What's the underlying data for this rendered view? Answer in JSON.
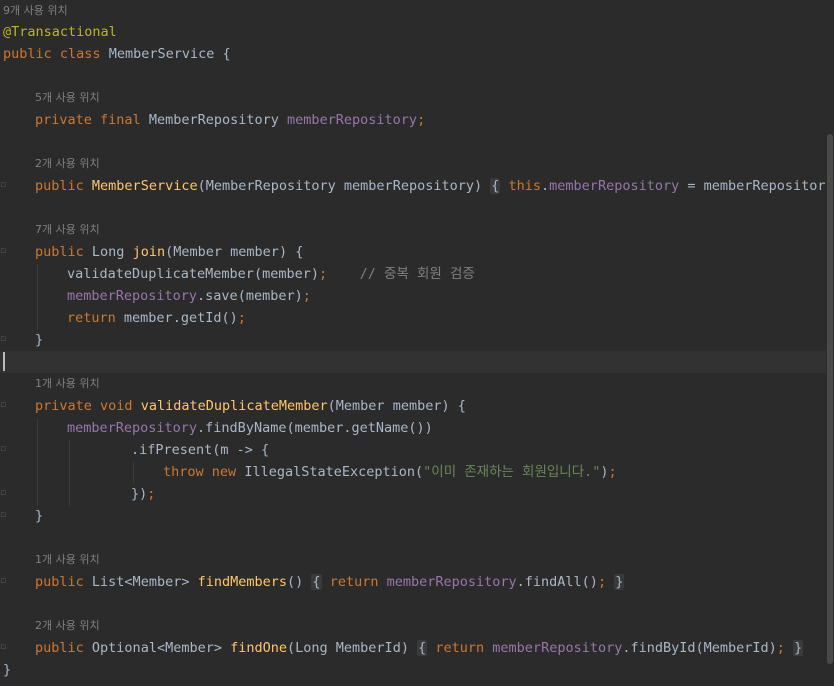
{
  "hints": {
    "h1": "9개 사용 위치",
    "h2": "5개 사용 위치",
    "h3": "2개 사용 위치",
    "h4": "7개 사용 위치",
    "h5": "1개 사용 위치",
    "h6": "1개 사용 위치",
    "h7": "2개 사용 위치"
  },
  "code": {
    "annotation": "@Transactional",
    "kw_public": "public",
    "kw_class": "class",
    "class_name": "MemberService",
    "kw_private": "private",
    "kw_final": "final",
    "kw_void": "void",
    "kw_return": "return",
    "kw_this": "this",
    "kw_throw": "throw",
    "kw_new": "new",
    "type_repo": "MemberRepository",
    "type_long": "Long",
    "type_member": "Member",
    "field_repo": "memberRepository",
    "param_repo": "memberRepository",
    "ctor_name": "MemberService",
    "m_join": "join",
    "m_validate": "validateDuplicateMember",
    "m_findMembers": "findMembers",
    "m_findOne": "findOne",
    "param_member": "member",
    "call_validate": "validateDuplicateMember",
    "call_save": ".save",
    "call_getId": "member.getId()",
    "comment_dup": "// 중복 회원 검증",
    "call_findByName": ".findByName(member.getName())",
    "call_ifPresent": ".ifPresent(m -> {",
    "exception": "IllegalStateException",
    "exception_msg": "\"이미 존재하는 회원입니다.\"",
    "list_member": "List<Member>",
    "optional_member": "Optional<Member>",
    "call_findAll": ".findAll()",
    "call_findById": ".findById(MemberId)",
    "param_long_memberid": "Long MemberId"
  }
}
